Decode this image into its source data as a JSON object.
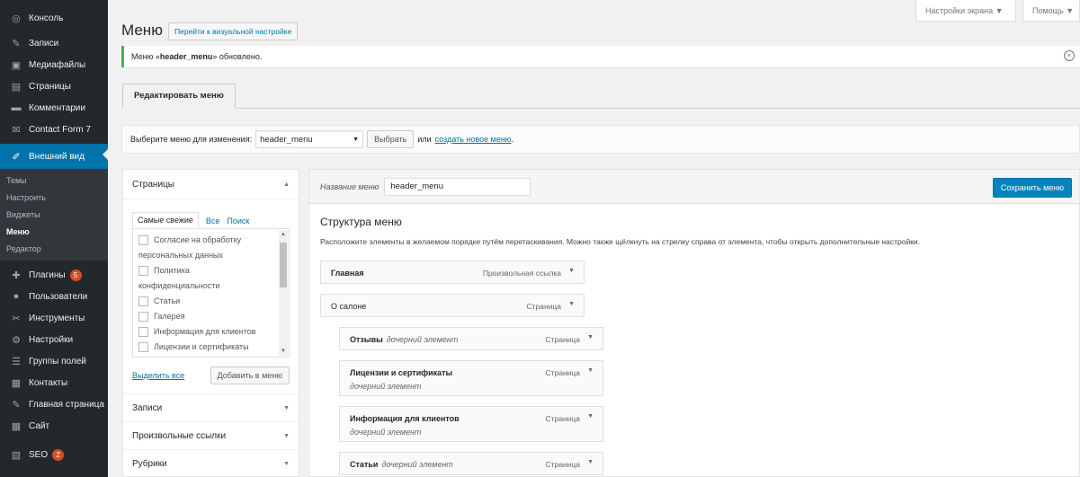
{
  "sidebar": {
    "items": [
      {
        "label": "Консоль",
        "icon": "dashboard-icon",
        "glyph": "◎"
      },
      {
        "label": "Записи",
        "icon": "pushpin-icon",
        "glyph": "✎"
      },
      {
        "label": "Медиафайлы",
        "icon": "media-icon",
        "glyph": "▣"
      },
      {
        "label": "Страницы",
        "icon": "page-icon",
        "glyph": "▤"
      },
      {
        "label": "Комментарии",
        "icon": "comment-icon",
        "glyph": "▬"
      },
      {
        "label": "Contact Form 7",
        "icon": "mail-icon",
        "glyph": "✉"
      },
      {
        "label": "Внешний вид",
        "icon": "brush-icon",
        "glyph": "✐"
      }
    ],
    "submenu": [
      "Темы",
      "Настроить",
      "Виджеты",
      "Меню",
      "Редактор"
    ],
    "items2": [
      {
        "label": "Плагины",
        "icon": "plugin-icon",
        "glyph": "✚",
        "badge": "5"
      },
      {
        "label": "Пользователи",
        "icon": "user-icon",
        "glyph": "●"
      },
      {
        "label": "Инструменты",
        "icon": "wrench-icon",
        "glyph": "✂"
      },
      {
        "label": "Настройки",
        "icon": "settings-icon",
        "glyph": "⚙"
      },
      {
        "label": "Группы полей",
        "icon": "fields-icon",
        "glyph": "☰"
      },
      {
        "label": "Контакты",
        "icon": "contacts-icon",
        "glyph": "▦"
      },
      {
        "label": "Главная страница",
        "icon": "home-icon",
        "glyph": "✎"
      },
      {
        "label": "Сайт",
        "icon": "site-icon",
        "glyph": "▦"
      },
      {
        "label": "SEO",
        "icon": "seo-icon",
        "glyph": "▧",
        "badge": "2"
      }
    ]
  },
  "top": {
    "screen_options": "Настройки экрана",
    "help": "Помощь"
  },
  "header": {
    "title": "Меню",
    "visual_button": "Перейти к визуальной настройке"
  },
  "notice": {
    "prefix": "Меню «",
    "menu_name": "header_menu",
    "suffix": "» обновлено."
  },
  "tabs": {
    "edit": "Редактировать меню"
  },
  "manage": {
    "label": "Выберите меню для изменения:",
    "selected": "header_menu",
    "select_button": "Выбрать",
    "or": "или",
    "create_link": "создать новое меню",
    "dot": "."
  },
  "left": {
    "pages_title": "Страницы",
    "subtabs": [
      "Самые свежие",
      "Все",
      "Поиск"
    ],
    "checklist": [
      {
        "text": "Согласие на обработку",
        "checkbox": true
      },
      {
        "text": "персональных данных",
        "checkbox": false
      },
      {
        "text": "Политика",
        "checkbox": true
      },
      {
        "text": "конфиденциальности",
        "checkbox": false
      },
      {
        "text": "Статьи",
        "checkbox": true
      },
      {
        "text": "Галерея",
        "checkbox": true
      },
      {
        "text": "Информация для клиентов",
        "checkbox": true
      },
      {
        "text": "Лицензии и сертификаты",
        "checkbox": true
      }
    ],
    "select_all": "Выделить все",
    "add_button": "Добавить в меню",
    "sections": [
      "Записи",
      "Произвольные ссылки",
      "Рубрики"
    ]
  },
  "right": {
    "name_label": "Название меню",
    "name_value": "header_menu",
    "save_button": "Сохранить меню",
    "structure_title": "Структура меню",
    "structure_desc": "Расположите элементы в желаемом порядке путём перетаскивания. Можно также щёлкнуть на стрелку справа от элемента, чтобы открыть дополнительные настройки.",
    "items": [
      {
        "title": "Главная",
        "type": "Произвольная ссылка"
      },
      {
        "title": "О салоне",
        "type": "Страница"
      },
      {
        "title": "Отзывы",
        "sub": "дочерний элемент",
        "type": "Страница"
      },
      {
        "title": "Лицензии и сертификаты",
        "sub": "дочерний элемент",
        "type": "Страница"
      },
      {
        "title": "Информация для клиентов",
        "sub": "дочерний элемент",
        "type": "Страница"
      },
      {
        "title": "Статьи",
        "sub": "дочерний элемент",
        "type": "Страница"
      }
    ]
  },
  "colors": {
    "sidebar_bg": "#23282d",
    "accent": "#0073aa",
    "notice_success": "#46b450",
    "badge": "#d54e21"
  }
}
